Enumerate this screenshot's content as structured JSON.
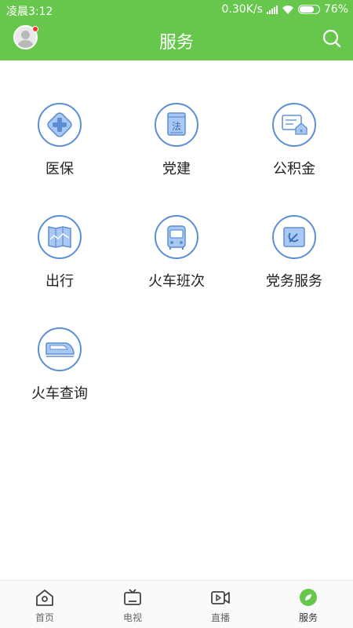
{
  "status_bar": {
    "time": "凌晨3:12",
    "network_speed": "0.30K/s",
    "battery": "76%",
    "battery_level": 0.76
  },
  "header": {
    "title": "服务",
    "avatar_icon": "user-avatar",
    "search_icon": "search-icon"
  },
  "services": [
    {
      "label": "医保",
      "icon": "medical-insurance-icon"
    },
    {
      "label": "党建",
      "icon": "law-book-icon"
    },
    {
      "label": "公积金",
      "icon": "housing-fund-icon"
    },
    {
      "label": "出行",
      "icon": "map-icon"
    },
    {
      "label": "火车班次",
      "icon": "bus-icon"
    },
    {
      "label": "党务服务",
      "icon": "party-flag-icon"
    },
    {
      "label": "火车查询",
      "icon": "high-speed-train-icon"
    }
  ],
  "tabbar": {
    "items": [
      {
        "label": "首页",
        "icon": "home-icon"
      },
      {
        "label": "电视",
        "icon": "tv-icon"
      },
      {
        "label": "直播",
        "icon": "video-camera-icon"
      },
      {
        "label": "服务",
        "icon": "compass-leaf-icon",
        "active": true
      }
    ]
  },
  "colors": {
    "brand_green": "#66c74c",
    "icon_blue": "#5b8ed6",
    "icon_fill": "#a9c8f2",
    "notification_red": "#ff3030"
  }
}
